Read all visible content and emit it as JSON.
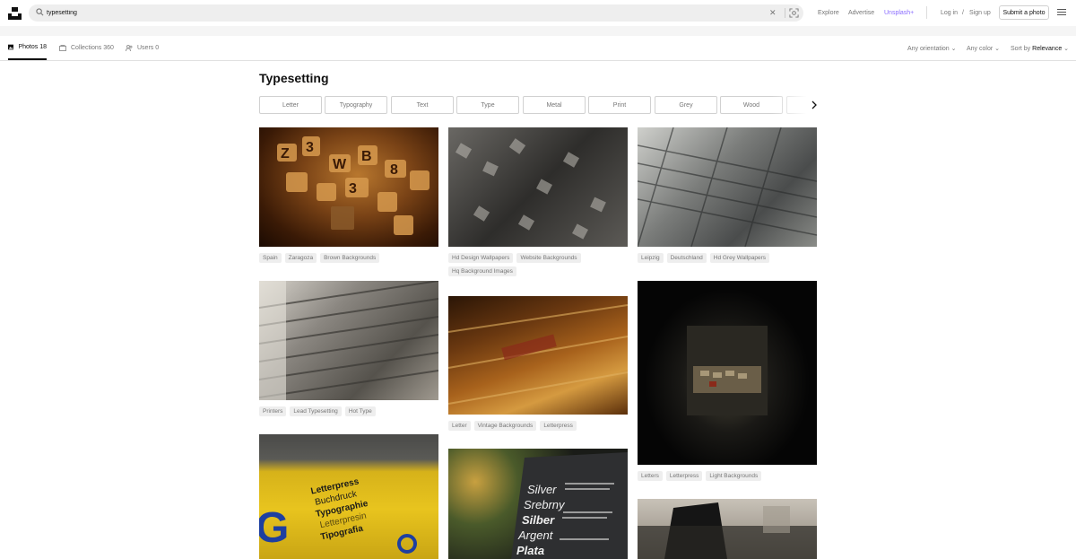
{
  "search": {
    "value": "typesetting"
  },
  "nav": {
    "explore": "Explore",
    "advertise": "Advertise",
    "unsplash_plus": "Unsplash+",
    "login": "Log in",
    "slash": "/",
    "signup": "Sign up",
    "submit": "Submit a photo"
  },
  "tabs": [
    {
      "label": "Photos",
      "count": "18"
    },
    {
      "label": "Collections",
      "count": "360"
    },
    {
      "label": "Users",
      "count": "0"
    }
  ],
  "filters": {
    "orientation": "Any orientation",
    "color": "Any color",
    "sort_prefix": "Sort by",
    "sort_value": "Relevance"
  },
  "heading": "Typesetting",
  "related": [
    "Letter",
    "Typography",
    "Text",
    "Type",
    "Metal",
    "Print",
    "Grey",
    "Wood"
  ],
  "photos": [
    {
      "tags": [
        "Spain",
        "Zaragoza",
        "Brown Backgrounds"
      ]
    },
    {
      "tags": [
        "Printers",
        "Lead Typesetting",
        "Hot Type"
      ]
    },
    {
      "text": [
        "Letterpress",
        "Buchdruck",
        "Typographie",
        "Letterpresin",
        "Tipografia"
      ]
    },
    {
      "tags": [
        "Hd Design Wallpapers",
        "Website Backgrounds",
        "Hq Background Images"
      ]
    },
    {
      "tags": [
        "Letter",
        "Vintage Backgrounds",
        "Letterpress"
      ]
    },
    {
      "text": [
        "Silver",
        "Srebrny",
        "Silber",
        "Argent",
        "Plata"
      ]
    },
    {
      "tags": [
        "Leipzig",
        "Deutschland",
        "Hd Grey Wallpapers"
      ]
    },
    {
      "tags": [
        "Letters",
        "Letterpress",
        "Light Backgrounds"
      ]
    }
  ],
  "colors": {
    "accent": "#8a6cff",
    "text_gray": "#767676",
    "tag_bg": "#eeeeee"
  }
}
